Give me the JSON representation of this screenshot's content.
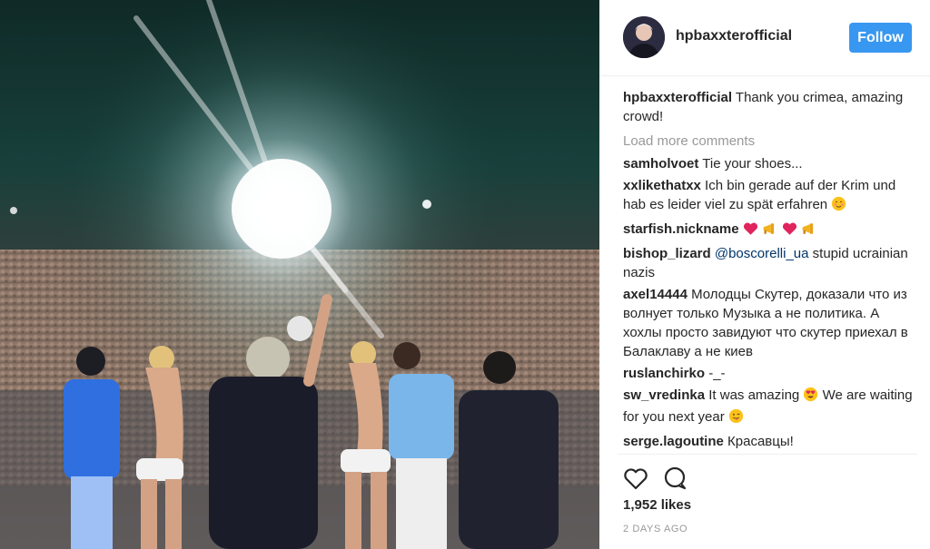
{
  "post": {
    "username": "hpbaxxterofficial",
    "follow_label": "Follow",
    "caption": {
      "user": "hpbaxxterofficial",
      "text": " Thank you crimea, amazing crowd!"
    },
    "load_more": "Load more comments",
    "comments": [
      {
        "user": "samholvoet",
        "text": " Tie your shoes..."
      },
      {
        "user": "xxlikethatxx",
        "text": " Ich bin gerade auf der Krim und hab es leider viel zu spät erfahren "
      },
      {
        "user": "starfish.nickname",
        "text": " "
      },
      {
        "user": "bishop_lizard",
        "mention": " @boscorelli_ua",
        "text": " stupid ucrainian nazis"
      },
      {
        "user": "axel14444",
        "text": " Молодцы Скутер, доказали что из волнует только Музыка а не политика. А хохлы просто завидуют что скутер приехал в Балаклаву а не киев"
      },
      {
        "user": "ruslanchirko",
        "text": " -_-"
      },
      {
        "user": "sw_vredinka",
        "text": " It was amazing ",
        "text2": " We are waiting for you next year "
      },
      {
        "user": "serge.lagoutine",
        "text": " Красавцы!"
      }
    ],
    "likes": "1,952 likes",
    "timestamp": "2 DAYS AGO"
  },
  "icons": {
    "like": "heart-outline-icon",
    "comment": "speech-bubble-icon",
    "emoji_blush": "blushing-face-emoji",
    "emoji_heart": "red-heart-emoji",
    "emoji_megaphone": "megaphone-emoji",
    "emoji_hearteyes": "heart-eyes-emoji",
    "emoji_tongue": "winking-tongue-emoji"
  },
  "colors": {
    "follow_button": "#3897f0",
    "muted_text": "#999999",
    "mention": "#003569",
    "heart": "#e0245e"
  }
}
